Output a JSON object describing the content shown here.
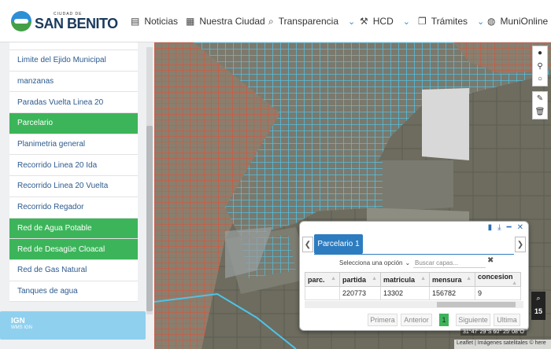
{
  "header": {
    "logo_small": "CIUDAD DE",
    "logo_big": "SAN BENITO",
    "nav": [
      {
        "label": "Noticias",
        "icon": "newspaper-icon"
      },
      {
        "label": "Nuestra Ciudad",
        "icon": "building-icon"
      },
      {
        "label": "Transparencia",
        "icon": "search-icon"
      },
      {
        "label": "HCD",
        "icon": "gavel-icon"
      },
      {
        "label": "Trámites",
        "icon": "copy-icon"
      },
      {
        "label": "MuniOnline",
        "icon": "globe-icon"
      }
    ]
  },
  "sidebar": {
    "layers": [
      {
        "label": "Limite del Ejido Municipal",
        "active": false
      },
      {
        "label": "manzanas",
        "active": false
      },
      {
        "label": "Paradas Vuelta Linea 20",
        "active": false
      },
      {
        "label": "Parcelario",
        "active": true
      },
      {
        "label": "Planimetria general",
        "active": false
      },
      {
        "label": "Recorrido Linea 20 Ida",
        "active": false
      },
      {
        "label": "Recorrido Linea 20 Vuelta",
        "active": false
      },
      {
        "label": "Recorrido Regador",
        "active": false
      },
      {
        "label": "Red de Agua Potable",
        "active": true
      },
      {
        "label": "Red de Desagüe Cloacal",
        "active": true
      },
      {
        "label": "Red de Gas Natural",
        "active": false
      },
      {
        "label": "Tanques de agua",
        "active": false
      }
    ],
    "source_title": "IGN",
    "source_sub": "WMS IGN"
  },
  "popup": {
    "tab": "Parcelario 1",
    "select_placeholder": "Selecciona una opción",
    "search_placeholder": "Buscar capas...",
    "columns": [
      "parc.",
      "partida",
      "matricula",
      "mensura",
      "concesion"
    ],
    "rows": [
      [
        "",
        "220773",
        "13302",
        "156782",
        "9"
      ]
    ],
    "pager": {
      "first": "Primera",
      "prev": "Anterior",
      "current": "1",
      "next": "Siguiente",
      "last": "Ultima"
    }
  },
  "map": {
    "coords": "31°47' 29\"S 60° 25' 08\"O",
    "attribution": "Leaflet | Imágenes satelitales © here",
    "zoom_level": "15"
  },
  "colors": {
    "accent_green": "#3cb55a",
    "accent_blue": "#2d7cc0",
    "parcel_red": "#d9533a",
    "water_cyan": "#4fc3e8"
  }
}
